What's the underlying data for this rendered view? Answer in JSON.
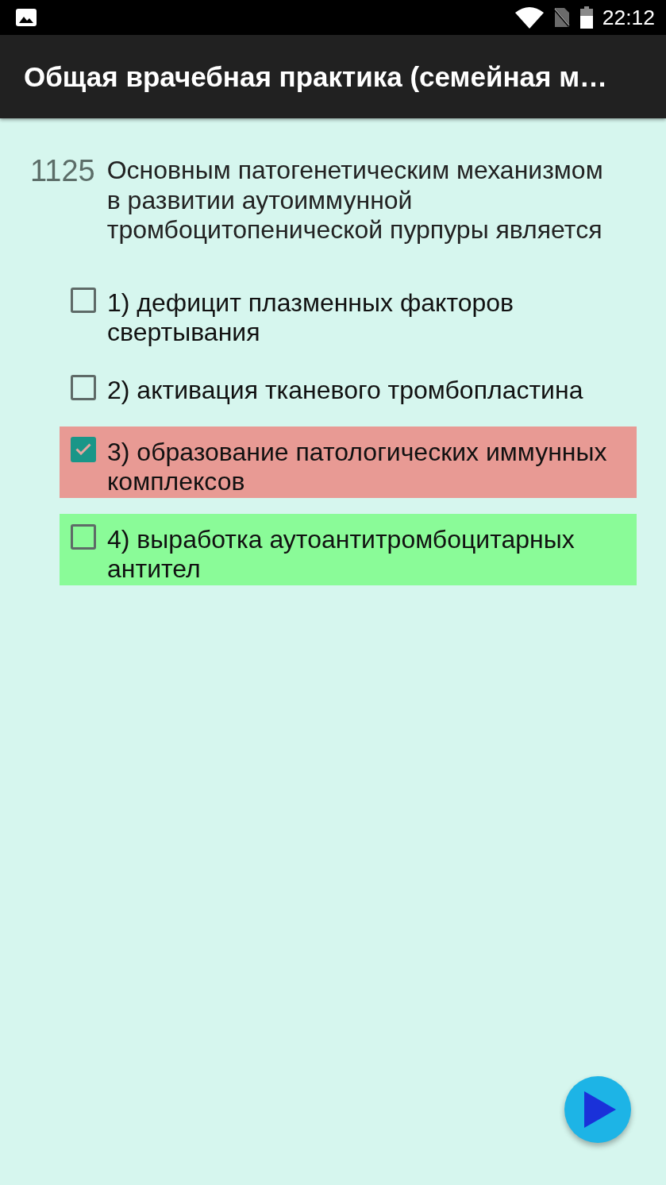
{
  "status_bar": {
    "time": "22:12"
  },
  "app_bar": {
    "title": "Общая врачебная практика (семейная м…"
  },
  "question": {
    "number": "1125",
    "text": "Основным патогенетическим механизмом в развитии аутоиммунной тромбоцитопенической пурпуры является"
  },
  "options": [
    {
      "text": "1) дефицит плазменных факторов свертывания",
      "checked": false,
      "correct": false
    },
    {
      "text": "2) активация тканевого тромбопластина",
      "checked": false,
      "correct": false
    },
    {
      "text": "3) образование патологических иммунных комплексов",
      "checked": true,
      "correct": false
    },
    {
      "text": "4) выработка аутоантитромбоцитарных антител",
      "checked": false,
      "correct": true
    }
  ]
}
